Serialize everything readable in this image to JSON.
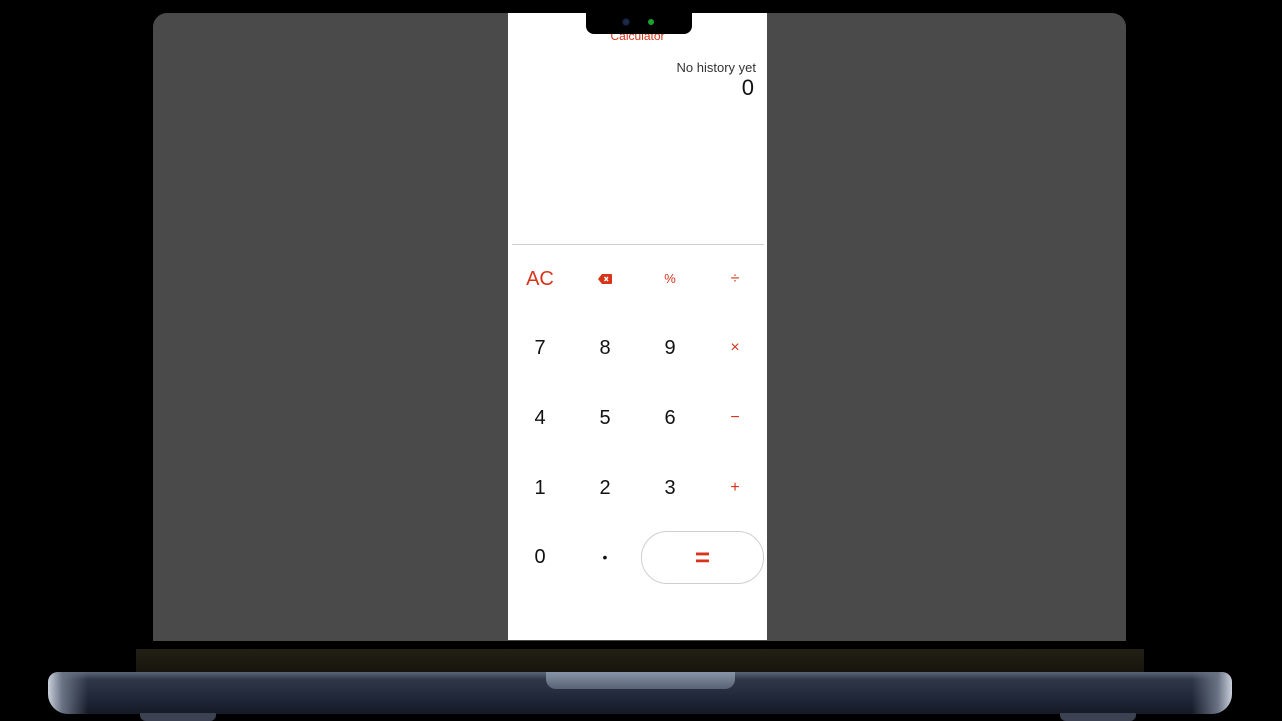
{
  "app": {
    "title": "Calculator",
    "history_text": "No history yet",
    "display_value": "0",
    "accent_color": "#d8341a"
  },
  "keys": {
    "row1": [
      "AC",
      "backspace-icon",
      "%",
      "÷"
    ],
    "row2": [
      "7",
      "8",
      "9",
      "×"
    ],
    "row3": [
      "4",
      "5",
      "6",
      "−"
    ],
    "row4": [
      "1",
      "2",
      "3",
      "+"
    ],
    "row5": [
      "0",
      "•",
      "="
    ]
  }
}
